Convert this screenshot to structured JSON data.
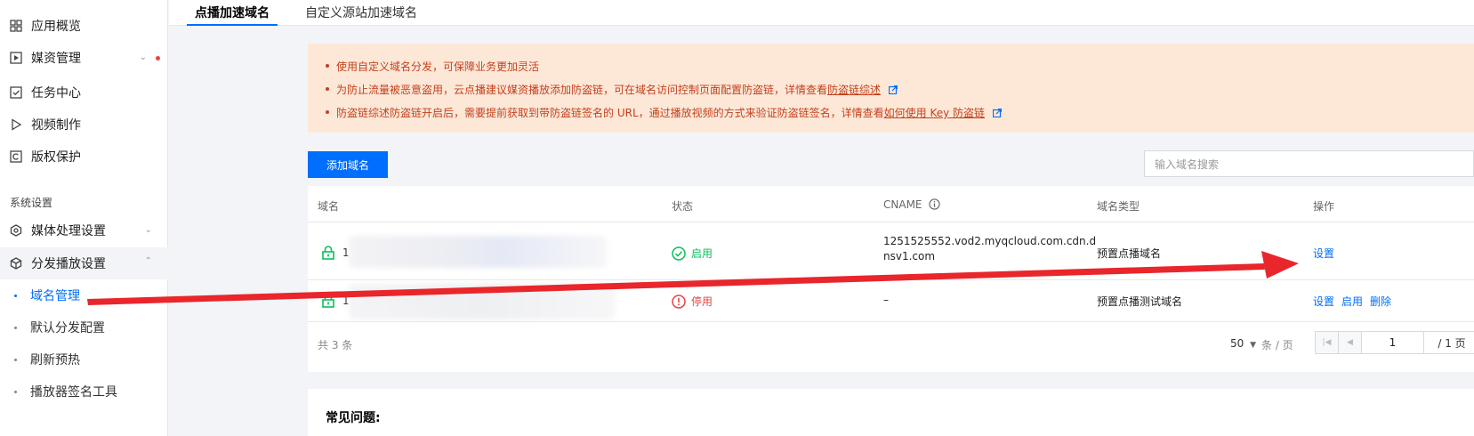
{
  "sidebar": {
    "items": [
      {
        "label": "应用概览",
        "icon": "grid-icon"
      },
      {
        "label": "媒资管理",
        "icon": "media-icon"
      },
      {
        "label": "任务中心",
        "icon": "task-icon"
      },
      {
        "label": "视频制作",
        "icon": "play-icon"
      },
      {
        "label": "版权保护",
        "icon": "copyright-icon"
      }
    ],
    "section_title": "系统设置",
    "groups": [
      {
        "label": "媒体处理设置",
        "icon": "media-process-icon"
      },
      {
        "label": "分发播放设置",
        "icon": "distribution-icon"
      }
    ],
    "sub_items": [
      {
        "label": "域名管理"
      },
      {
        "label": "默认分发配置"
      },
      {
        "label": "刷新预热"
      },
      {
        "label": "播放器签名工具"
      }
    ]
  },
  "tabs": [
    {
      "label": "点播加速域名"
    },
    {
      "label": "自定义源站加速域名"
    }
  ],
  "alert": {
    "line1": "使用自定义域名分发，可保障业务更加灵活",
    "line2_text": "为防止流量被恶意盗用，云点播建议媒资播放添加防盗链，可在域名访问控制页面配置防盗链，详情查看",
    "line2_link": "防盗链综述",
    "line3_text": "防盗链综述防盗链开启后，需要提前获取到带防盗链签名的 URL，通过播放视频的方式来验证防盗链签名，详情查看",
    "line3_link": "如何使用 Key 防盗链"
  },
  "toolbar": {
    "add_label": "添加域名",
    "search_placeholder": "输入域名搜索"
  },
  "table": {
    "headers": {
      "domain": "域名",
      "status": "状态",
      "cname": "CNAME",
      "type": "域名类型",
      "actions": "操作"
    },
    "rows": [
      {
        "domain_prefix": "1",
        "status": "启用",
        "cname_line1": "1251525552.vod2.myqcloud.com.cdn.d",
        "cname_line2": "nsv1.com",
        "type": "预置点播域名",
        "actions": [
          "设置"
        ]
      },
      {
        "domain_prefix": "1",
        "status": "停用",
        "cname_line1": "–",
        "type": "预置点播测试域名",
        "actions": [
          "设置",
          "启用",
          "删除"
        ]
      }
    ],
    "total": "共 3 条",
    "page_size": "50",
    "page_unit": "条 / 页",
    "page_current": "1",
    "page_total": "/ 1 页"
  },
  "faq": {
    "title": "常见问题:"
  },
  "colors": {
    "accent": "#006eff",
    "alert_bg": "#fde8d8",
    "alert_text": "#c4401c",
    "success": "#0abf5b",
    "danger": "#e54545",
    "annotation_arrow": "#e8262b"
  }
}
